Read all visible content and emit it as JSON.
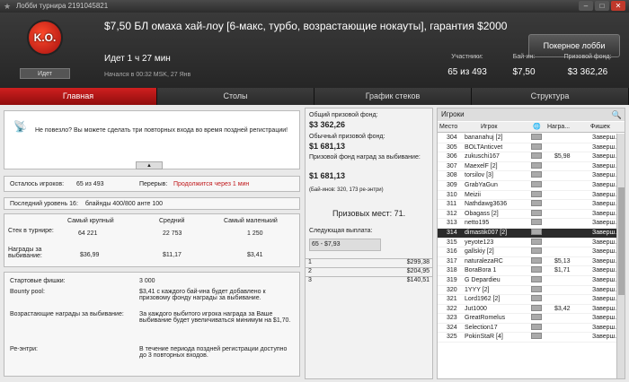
{
  "window": {
    "title": "Лобби турнира 2191045821"
  },
  "header": {
    "logo_text": "K.O.",
    "status": "Идет",
    "tournament_name": "$7,50 БЛ омаха хай-лоу [6-макс, турбо, возрастающие нокауты], гарантия $2000",
    "elapsed": "Идет 1 ч 27 мин",
    "started": "Начался в 00:32 MSK, 27 Янв",
    "poker_lobby_button": "Покерное лобби",
    "stats": [
      {
        "label": "Участники:",
        "value": "65 из 493"
      },
      {
        "label": "Бай-ин:",
        "value": "$7,50"
      },
      {
        "label": "Призовой фонд:",
        "value": "$3 362,26"
      }
    ]
  },
  "tabs": [
    "Главная",
    "Столы",
    "График стеков",
    "Структура"
  ],
  "main": {
    "message": "Не повезло? Вы можете сделать три повторных входа во время поздней регистрации!",
    "players_left_label": "Осталось игроков:",
    "players_left_value": "65 из 493",
    "break_label": "Перерыв:",
    "break_value": "Продолжится через 1 мин",
    "level_label": "Последний уровень 16:",
    "level_value": "блайнды 400/800 анте 100",
    "stack_headers": [
      "Самый крупный",
      "Средний",
      "Самый маленький"
    ],
    "stack_label": "Стек в турнире:",
    "stack_values": [
      "64 221",
      "22 753",
      "1 250"
    ],
    "bounty_label": "Награды за выбивание:",
    "bounty_values": [
      "$36,99",
      "$11,17",
      "$3,41"
    ],
    "info": [
      {
        "label": "Стартовые фишки:",
        "value": "3 000"
      },
      {
        "label": "Bounty pool:",
        "value": "$3,41 с каждого бай-ина будет добавлено к призовому фонду награды за выбивание."
      },
      {
        "label": "Возрастающие награды за выбивание:",
        "value": "За каждого выбитого игрока награда за Ваше выбивание будет увеличиваться минимум на $1,70."
      },
      {
        "label": "Ре-энтри:",
        "value": "В течение периода поздней регистрации доступно до 3 повторных входов."
      }
    ]
  },
  "prize": {
    "total_label": "Общий призовой фонд:",
    "total_value": "$3 362,26",
    "regular_label": "Обычный призовой фонд:",
    "regular_value": "$1 681,13",
    "bounty_label": "Призовой фонд наград за выбивание:",
    "bounty_value": "$1 681,13",
    "buyins_note": "(Бай-инов: 320, 173 ре-энтри)",
    "places_label": "Призовых мест: 71.",
    "next_payout_label": "Следующая выплата:",
    "next_payout_value": "65 - $7,93",
    "payouts": [
      {
        "place": "1",
        "amount": "$299,38"
      },
      {
        "place": "2",
        "amount": "$204,95"
      },
      {
        "place": "3",
        "amount": "$140,51"
      }
    ]
  },
  "players": {
    "title": "Игроки",
    "columns": [
      "Место",
      "Игрок",
      "Награ...",
      "Фишек"
    ],
    "rows": [
      {
        "place": "304",
        "name": "bananahuj [2]",
        "bounty": "",
        "chips": "Заверш."
      },
      {
        "place": "305",
        "name": "BOLTAnticvet",
        "bounty": "",
        "chips": "Заверш."
      },
      {
        "place": "306",
        "name": "zukuschi167",
        "bounty": "$5,98",
        "chips": "Заверш."
      },
      {
        "place": "307",
        "name": "MaexelF [2]",
        "bounty": "",
        "chips": "Заверш."
      },
      {
        "place": "308",
        "name": "torsilov [3]",
        "bounty": "",
        "chips": "Заверш."
      },
      {
        "place": "309",
        "name": "GrabYaGun",
        "bounty": "",
        "chips": "Заверш."
      },
      {
        "place": "310",
        "name": "Meizii",
        "bounty": "",
        "chips": "Заверш."
      },
      {
        "place": "311",
        "name": "Nathdawg3636",
        "bounty": "",
        "chips": "Заверш."
      },
      {
        "place": "312",
        "name": "Obagass [2]",
        "bounty": "",
        "chips": "Заверш."
      },
      {
        "place": "313",
        "name": "netto195",
        "bounty": "",
        "chips": "Заверш."
      },
      {
        "place": "314",
        "name": "dimastik007 [2]",
        "bounty": "",
        "chips": "Заверш."
      },
      {
        "place": "315",
        "name": "yeyote123",
        "bounty": "",
        "chips": "Заверш."
      },
      {
        "place": "316",
        "name": "gallskiy [2]",
        "bounty": "",
        "chips": "Заверш."
      },
      {
        "place": "317",
        "name": "naturalezaRC",
        "bounty": "$5,13",
        "chips": "Заверш."
      },
      {
        "place": "318",
        "name": "BoraBora 1",
        "bounty": "$1,71",
        "chips": "Заверш."
      },
      {
        "place": "319",
        "name": "G Depardieu",
        "bounty": "",
        "chips": "Заверш."
      },
      {
        "place": "320",
        "name": "1YYY [2]",
        "bounty": "",
        "chips": "Заверш."
      },
      {
        "place": "321",
        "name": "Lord1962 [2]",
        "bounty": "",
        "chips": "Заверш."
      },
      {
        "place": "322",
        "name": "Jut1000",
        "bounty": "$3,42",
        "chips": "Заверш."
      },
      {
        "place": "323",
        "name": "GreatRomelus",
        "bounty": "",
        "chips": "Заверш."
      },
      {
        "place": "324",
        "name": "Selection17",
        "bounty": "",
        "chips": "Заверш."
      },
      {
        "place": "325",
        "name": "PokinStaR [4]",
        "bounty": "",
        "chips": "Заверш."
      }
    ]
  }
}
